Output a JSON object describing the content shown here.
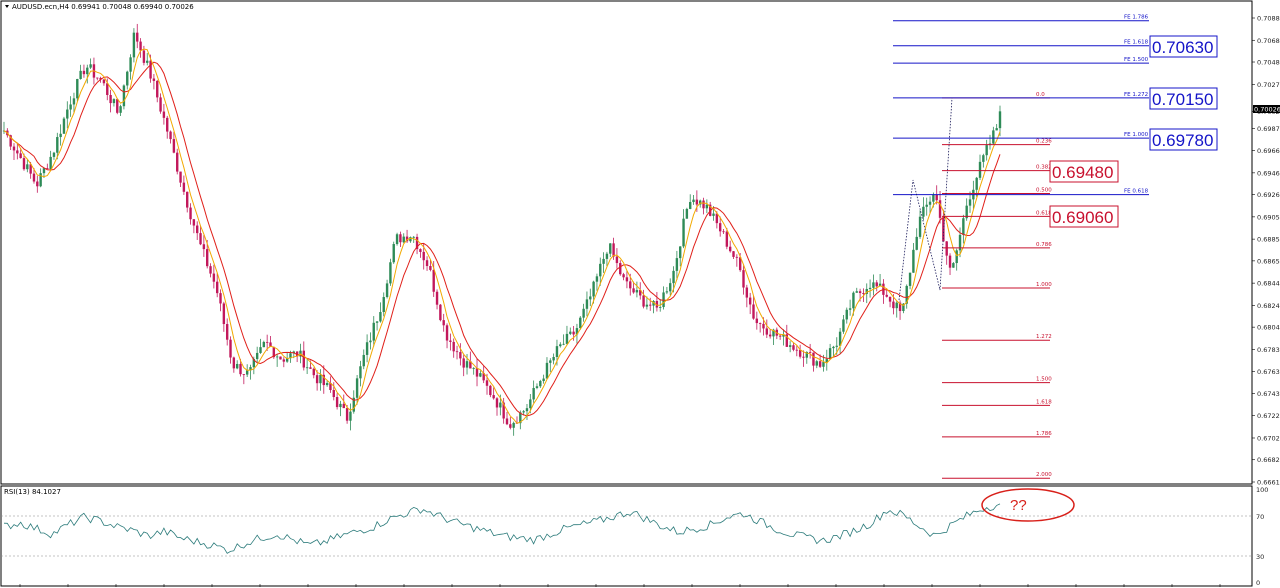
{
  "header": {
    "symbol_line": "AUDUSD.ecn,H4  0.69941 0.70048 0.69940 0.70026"
  },
  "price_axis": {
    "ticks": [
      "0.70885",
      "0.70680",
      "0.70480",
      "0.70275",
      "0.70026",
      "0.69870",
      "0.69665",
      "0.69460",
      "0.69260",
      "0.69055",
      "0.68850",
      "0.68650",
      "0.68445",
      "0.68240",
      "0.68040",
      "0.67835",
      "0.67630",
      "0.67430",
      "0.67225",
      "0.67020",
      "0.66820",
      "0.66615"
    ],
    "current_price": "0.70026"
  },
  "fib_expansion": {
    "color": "#1414c8",
    "levels": [
      {
        "label": "FE 1.786",
        "price": 0.7086
      },
      {
        "label": "FE 1.618",
        "price": 0.7063
      },
      {
        "label": "FE 1.500",
        "price": 0.7047
      },
      {
        "label": "FE 1.272",
        "price": 0.7015
      },
      {
        "label": "FE 1.000",
        "price": 0.6978
      },
      {
        "label": "FE 0.618",
        "price": 0.6926
      }
    ]
  },
  "fib_retracement": {
    "color": "#c8102e",
    "levels": [
      {
        "label": "0.0",
        "price": 0.7015
      },
      {
        "label": "0.236",
        "price": 0.6972
      },
      {
        "label": "0.382",
        "price": 0.6948
      },
      {
        "label": "0.500",
        "price": 0.6927
      },
      {
        "label": "0.618",
        "price": 0.6906
      },
      {
        "label": "0.786",
        "price": 0.6877
      },
      {
        "label": "1.000",
        "price": 0.684
      },
      {
        "label": "1.272",
        "price": 0.6792
      },
      {
        "label": "1.500",
        "price": 0.6753
      },
      {
        "label": "1.618",
        "price": 0.6732
      },
      {
        "label": "1.786",
        "price": 0.6703
      },
      {
        "label": "2.000",
        "price": 0.6665
      }
    ]
  },
  "callouts": {
    "blue": [
      "0.70630",
      "0.70150",
      "0.69780"
    ],
    "red": [
      "0.69480",
      "0.69060"
    ]
  },
  "rsi": {
    "label": "RSI(13) 84.1027",
    "axis_ticks": [
      "100",
      "70",
      "30",
      "0"
    ],
    "question": "??",
    "color": "#2a7a7a",
    "level_values": [
      70,
      30
    ]
  },
  "colors": {
    "bull": "#2e8b57",
    "bear": "#c2185b",
    "ma_fast": "#f2a900",
    "ma_slow": "#e0201a"
  },
  "chart_data": {
    "type": "candlestick",
    "title": "AUDUSD.ecn,H4",
    "ohlc_last": {
      "open": 0.69941,
      "high": 0.70048,
      "low": 0.6994,
      "close": 0.70026
    },
    "ylim": [
      0.66615,
      0.70885
    ],
    "series_close_approx": [
      {
        "name": "close",
        "values": [
          0.6985,
          0.696,
          0.6935,
          0.6965,
          0.701,
          0.7045,
          0.703,
          0.7,
          0.7075,
          0.7035,
          0.6985,
          0.693,
          0.688,
          0.684,
          0.677,
          0.676,
          0.679,
          0.6775,
          0.678,
          0.676,
          0.6745,
          0.672,
          0.6775,
          0.682,
          0.6885,
          0.689,
          0.686,
          0.68,
          0.6775,
          0.676,
          0.674,
          0.6715,
          0.673,
          0.676,
          0.6785,
          0.68,
          0.6835,
          0.688,
          0.6845,
          0.683,
          0.682,
          0.6855,
          0.6925,
          0.6915,
          0.689,
          0.686,
          0.681,
          0.68,
          0.679,
          0.678,
          0.677,
          0.679,
          0.683,
          0.6845,
          0.6835,
          0.6815,
          0.69,
          0.693,
          0.685,
          0.692,
          0.696,
          0.6995
        ]
      }
    ],
    "rsi_values": [
      60,
      64,
      58,
      52,
      62,
      70,
      66,
      60,
      56,
      50,
      55,
      48,
      44,
      40,
      35,
      42,
      48,
      52,
      46,
      40,
      44,
      50,
      55,
      60,
      68,
      74,
      79,
      72,
      65,
      60,
      55,
      50,
      48,
      46,
      52,
      58,
      62,
      66,
      71,
      76,
      68,
      60,
      54,
      58,
      62,
      70,
      74,
      66,
      58,
      52,
      48,
      45,
      50,
      56,
      64,
      78,
      72,
      60,
      50,
      62,
      72,
      80,
      84
    ]
  }
}
